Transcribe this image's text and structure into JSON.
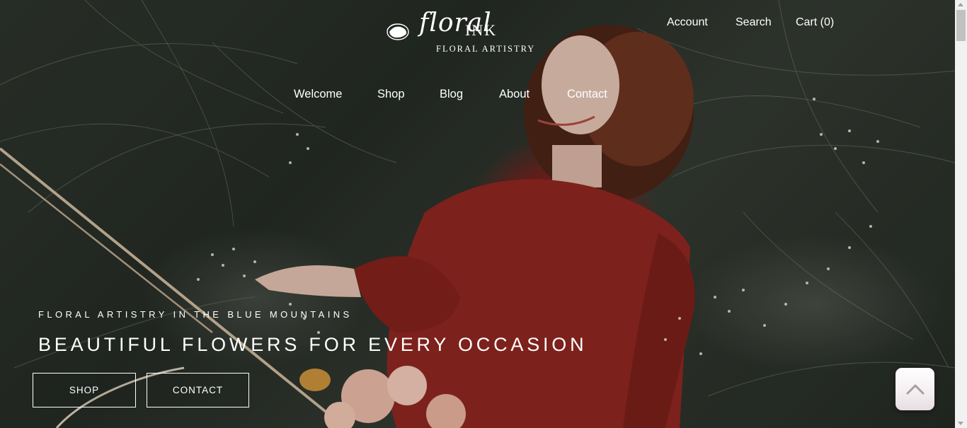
{
  "brand": {
    "script": "floral",
    "wordmark": "INK",
    "tagline": "FLORAL ARTISTRY"
  },
  "utility_nav": {
    "account": "Account",
    "search": "Search",
    "cart": "Cart (0)"
  },
  "main_nav": [
    "Welcome",
    "Shop",
    "Blog",
    "About",
    "Contact"
  ],
  "hero": {
    "kicker": "FLORAL ARTISTRY IN THE BLUE MOUNTAINS",
    "headline": "BEAUTIFUL FLOWERS FOR EVERY OCCASION",
    "buttons": {
      "shop": "SHOP",
      "contact": "CONTACT"
    }
  },
  "icons": {
    "logo_mark": "peony-flower-icon",
    "back_to_top": "chevron-up-icon"
  },
  "colors": {
    "text": "#ffffff",
    "dress": "#8e2620",
    "background": "#2d342c"
  }
}
